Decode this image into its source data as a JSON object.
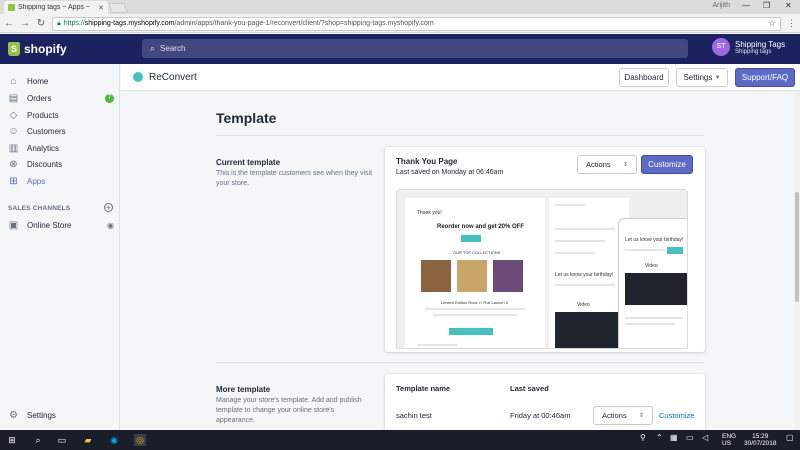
{
  "browser": {
    "tab_title": "Shipping tags ~ Apps ~",
    "window_user": "Arijith",
    "url_scheme": "https://",
    "url_host": "shipping-tags.myshopify.com",
    "url_path": "/admin/apps/thank-you-page-1/reconvert/client/?shop=shipping-tags.myshopify.com"
  },
  "topbar": {
    "logo_text": "shopify",
    "search_placeholder": "Search",
    "avatar_initials": "ST",
    "store_name": "Shipping Tags",
    "store_sub": "Shipping tags"
  },
  "sidebar": {
    "items": [
      {
        "label": "Home",
        "icon": "home-icon"
      },
      {
        "label": "Orders",
        "icon": "orders-icon",
        "badge": "7"
      },
      {
        "label": "Products",
        "icon": "tag-icon"
      },
      {
        "label": "Customers",
        "icon": "person-icon"
      },
      {
        "label": "Analytics",
        "icon": "chart-icon"
      },
      {
        "label": "Discounts",
        "icon": "discount-icon"
      },
      {
        "label": "Apps",
        "icon": "apps-icon"
      }
    ],
    "channels_heading": "SALES CHANNELS",
    "online_store": "Online Store",
    "settings": "Settings"
  },
  "appbar": {
    "title": "ReConvert",
    "dashboard": "Dashboard",
    "settings": "Settings",
    "support": "Support/FAQ"
  },
  "main": {
    "page_title": "Template",
    "current": {
      "title": "Current template",
      "desc": "This is the template customers see when they visit your store.",
      "card_title": "Thank You Page",
      "card_sub": "Last saved on Monday at 06:46am",
      "actions": "Actions",
      "customize": "Customize"
    },
    "preview": {
      "thankyou": "Thank you!",
      "headline": "Reorder now and get 20% OFF",
      "collection": "OUR TOP COLLECTIONS",
      "product": "Limited Edition Rock 'n' Roll Launch II",
      "birthday": "Let us know your birthday!",
      "video": "Video"
    },
    "more": {
      "title": "More template",
      "desc": "Manage your store's template. Add and publish template to change your online store's appearance.",
      "col_name": "Template name",
      "col_saved": "Last saved",
      "rows": [
        {
          "name": "sachin test",
          "saved": "Friday at 00:46am",
          "actions": "Actions",
          "customize": "Customize"
        }
      ]
    }
  },
  "taskbar": {
    "lang": "ENG",
    "region": "US",
    "time": "15:29",
    "date": "30/07/2018"
  },
  "colors": {
    "topbar": "#1c2260",
    "primary": "#5c6ac4",
    "brand_green": "#95bf47",
    "link": "#006fbb"
  }
}
